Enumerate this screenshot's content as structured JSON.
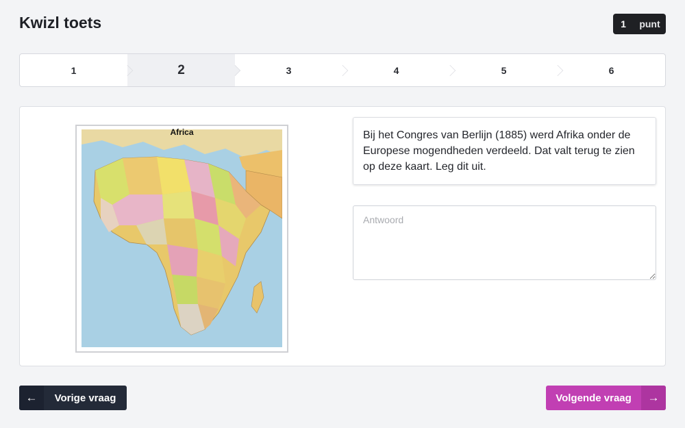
{
  "header": {
    "title": "Kwizl toets",
    "points_value": "1",
    "points_label": "punt"
  },
  "steps": [
    {
      "label": "1",
      "active": false
    },
    {
      "label": "2",
      "active": true
    },
    {
      "label": "3",
      "active": false
    },
    {
      "label": "4",
      "active": false
    },
    {
      "label": "5",
      "active": false
    },
    {
      "label": "6",
      "active": false
    }
  ],
  "map": {
    "title": "Africa"
  },
  "question": {
    "text": "Bij het Congres van Berlijn (1885) werd Afrika onder de Europese mogendheden verdeeld. Dat valt terug te zien op deze kaart. Leg dit uit."
  },
  "answer": {
    "placeholder": "Antwoord",
    "value": ""
  },
  "nav": {
    "prev_label": "Vorige vraag",
    "next_label": "Volgende vraag"
  },
  "colors": {
    "accent": "#c13fb3",
    "dark": "#232a38",
    "ocean": "#a8cfe3"
  }
}
